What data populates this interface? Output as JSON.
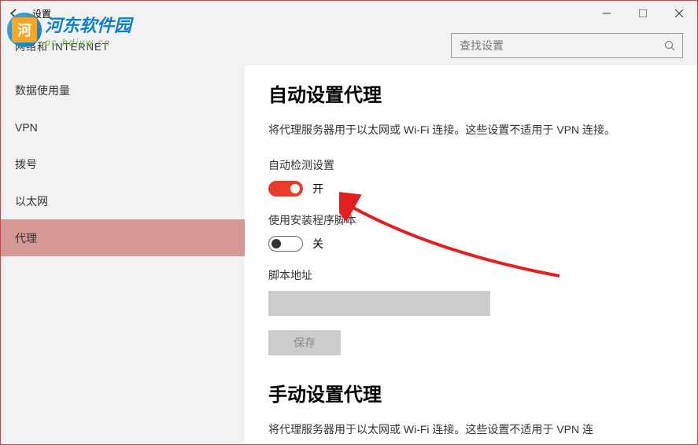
{
  "titlebar": {
    "title": "设置"
  },
  "header": {
    "category": "网络和 INTERNET",
    "search_placeholder": "查找设置"
  },
  "sidebar": {
    "items": [
      {
        "label": "数据使用量",
        "active": false
      },
      {
        "label": "VPN",
        "active": false
      },
      {
        "label": "拨号",
        "active": false
      },
      {
        "label": "以太网",
        "active": false
      },
      {
        "label": "代理",
        "active": true
      }
    ]
  },
  "main": {
    "auto_section": {
      "heading": "自动设置代理",
      "description": "将代理服务器用于以太网或 Wi-Fi 连接。这些设置不适用于 VPN 连接。",
      "auto_detect_label": "自动检测设置",
      "auto_detect_state": "开",
      "use_script_label": "使用安装程序脚本",
      "use_script_state": "关",
      "script_address_label": "脚本地址",
      "script_address_value": "",
      "save_button": "保存"
    },
    "manual_section": {
      "heading": "手动设置代理",
      "description": "将代理服务器用于以太网或 Wi-Fi 连接。这些设置不适用于 VPN 连"
    }
  },
  "watermark": {
    "text": "河东软件园",
    "subtext": "pc.hdjyw.cn"
  }
}
